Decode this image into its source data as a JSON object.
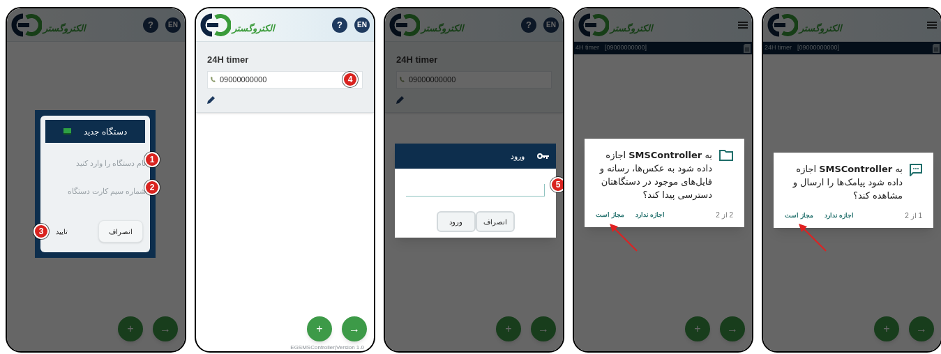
{
  "phones": [
    {
      "dimmed": true,
      "header": {
        "kind": "menu",
        "logo": "الکتروگستر"
      },
      "device_bar": {
        "name": "24H timer",
        "phone": "[09000000000]"
      },
      "dialog": {
        "kind": "sms_permission",
        "text": "به **SMSController** اجازه داده شود پیامک‌ها را ارسال و مشاهده کند؟",
        "counter": "1 از 2",
        "deny": "اجازه ندارد",
        "allow": "مجاز است",
        "arrow": true
      },
      "fabs": [
        "→",
        "+"
      ]
    },
    {
      "dimmed": true,
      "header": {
        "kind": "menu",
        "logo": "الکتروگستر"
      },
      "device_bar": {
        "name": "4H timer",
        "phone": "[09000000000]"
      },
      "dialog": {
        "kind": "storage_permission",
        "text": "به **SMSController** اجازه داده شود به عکس‌ها، رسانه و فایل‌های موجود در دستگاهتان دسترسی پیدا کند؟",
        "counter": "2 از 2",
        "deny": "اجازه ندارد",
        "allow": "مجاز است",
        "arrow": true
      },
      "fabs": [
        "→",
        "+"
      ]
    },
    {
      "dimmed": true,
      "header": {
        "kind": "help_language",
        "logo": "الکتروگستر",
        "help": "?",
        "language": "EN"
      },
      "device": {
        "name": "24H timer",
        "phone": "09000000000"
      },
      "dialog": {
        "kind": "login",
        "title": "ورود",
        "badge": "5",
        "buttons": [
          {
            "label": "انصراف",
            "kind": "outlined"
          },
          {
            "label": "ورود",
            "kind": "outlined"
          }
        ]
      },
      "fabs": [
        "→",
        "+"
      ]
    },
    {
      "dimmed": false,
      "header": {
        "kind": "help_language",
        "logo": "الکتروگستر",
        "help": "?",
        "language": "EN"
      },
      "device": {
        "name": "24H timer",
        "phone": "09000000000",
        "badge": "4"
      },
      "fabs": [
        "→",
        "+"
      ],
      "version": "EGSMSController|Version 1.0"
    },
    {
      "dimmed": true,
      "header": {
        "kind": "help_language",
        "logo": "الکتروگستر",
        "help": "?",
        "language": "EN"
      },
      "dialog": {
        "kind": "new_device",
        "title": "دستگاه جدید",
        "fields": [
          {
            "placeholder": "نام دستگاه را وارد کنید",
            "badge": "1"
          },
          {
            "placeholder": "شماره سیم کارت دستگاه",
            "badge": "2"
          }
        ],
        "buttons": [
          {
            "label": "انصراف",
            "kind": "outlined"
          },
          {
            "label": "تایید",
            "kind": "text",
            "badge": "3"
          }
        ]
      },
      "fabs": [
        "→",
        "+"
      ]
    }
  ]
}
